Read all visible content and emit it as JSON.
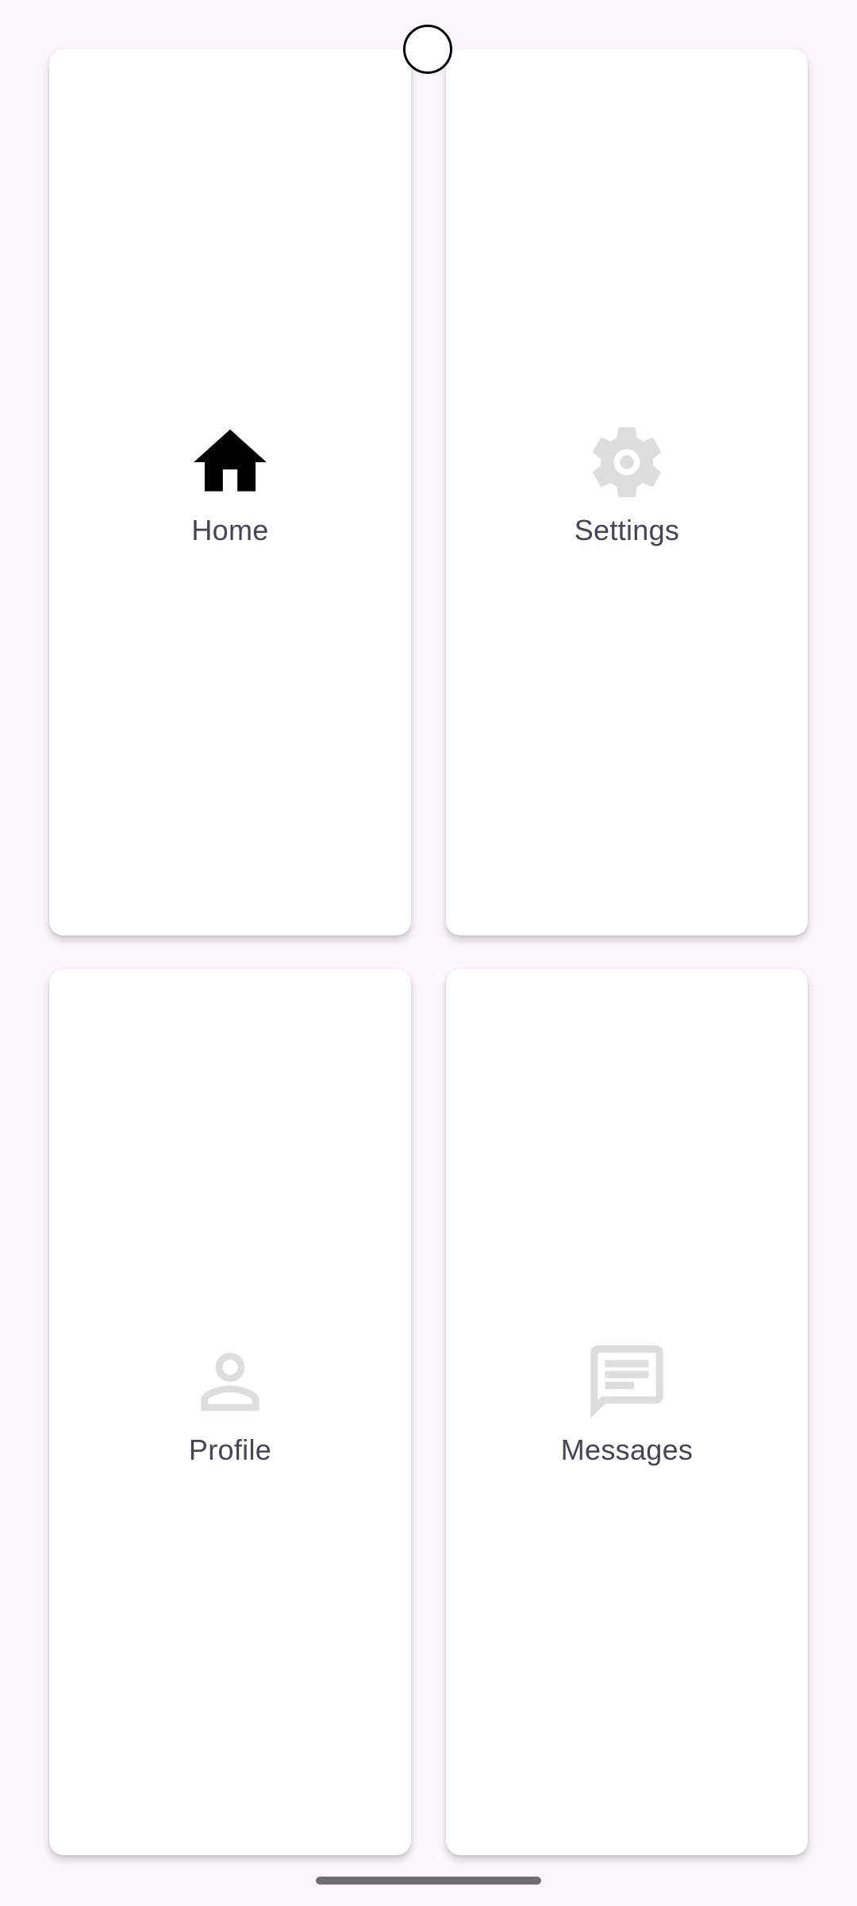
{
  "tiles": [
    {
      "label": "Home",
      "icon": "home-icon",
      "icon_color": "#000000",
      "selected": true
    },
    {
      "label": "Settings",
      "icon": "gear-icon",
      "icon_color": "#DDDDDD",
      "selected": false
    },
    {
      "label": "Profile",
      "icon": "person-icon",
      "icon_color": "#DDDDDD",
      "selected": false
    },
    {
      "label": "Messages",
      "icon": "message-icon",
      "icon_color": "#DDDDDD",
      "selected": false
    }
  ],
  "colors": {
    "background": "#FDF7FD",
    "card": "#FFFFFF",
    "label_text": "#45464F",
    "active_icon": "#000000",
    "inactive_icon": "#DDDDDD"
  }
}
